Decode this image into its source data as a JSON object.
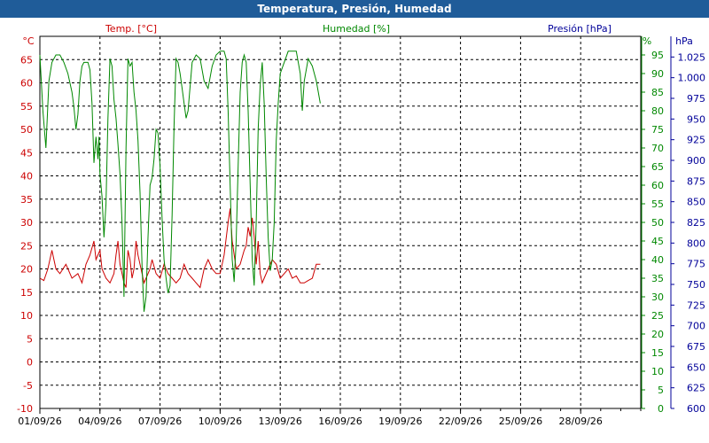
{
  "window": {
    "title": "Temperatura, Presión, Humedad"
  },
  "colors": {
    "temp": "#cc0000",
    "hum": "#008800",
    "pres": "#000099",
    "title_bar": "#1f5c99"
  },
  "chart_data": {
    "type": "line",
    "title": "Temperatura, Presión, Humedad",
    "grid": true,
    "x_ticks": [
      "01/09/26",
      "04/09/26",
      "07/09/26",
      "10/09/26",
      "13/09/26",
      "16/09/26",
      "19/09/26",
      "22/09/26",
      "25/09/26",
      "28/09/26"
    ],
    "x_range": [
      "01/09/26",
      "01/10/26"
    ],
    "axes": {
      "temp": {
        "unit_label": "°C",
        "header": "Temp. [°C]",
        "range": [
          -10,
          70
        ],
        "ticks": [
          -10,
          -5,
          0,
          5,
          10,
          15,
          20,
          25,
          30,
          35,
          40,
          45,
          50,
          55,
          60,
          65
        ]
      },
      "hum": {
        "unit_label": "%",
        "header": "Humedad [%]",
        "range": [
          0,
          100
        ],
        "ticks": [
          0,
          5,
          10,
          15,
          20,
          25,
          30,
          35,
          40,
          45,
          50,
          55,
          60,
          65,
          70,
          75,
          80,
          85,
          90,
          95
        ]
      },
      "pres": {
        "unit_label": "hPa",
        "header": "Presión [hPa]",
        "range": [
          600,
          1050
        ],
        "ticks": [
          "600",
          "625",
          "650",
          "675",
          "700",
          "725",
          "750",
          "775",
          "800",
          "825",
          "850",
          "875",
          "900",
          "925",
          "950",
          "975",
          "1.000",
          "1.025"
        ]
      }
    },
    "series": [
      {
        "name": "Temp. [°C]",
        "axis": "temp",
        "points": [
          [
            0.0,
            18
          ],
          [
            0.2,
            17.5
          ],
          [
            0.4,
            20
          ],
          [
            0.6,
            24
          ],
          [
            0.8,
            20
          ],
          [
            1.0,
            19
          ],
          [
            1.3,
            21
          ],
          [
            1.6,
            18
          ],
          [
            1.9,
            19
          ],
          [
            2.1,
            17
          ],
          [
            2.3,
            21
          ],
          [
            2.5,
            23
          ],
          [
            2.7,
            26
          ],
          [
            2.8,
            22
          ],
          [
            3.0,
            24
          ],
          [
            3.1,
            20
          ],
          [
            3.3,
            18
          ],
          [
            3.5,
            17
          ],
          [
            3.7,
            19
          ],
          [
            3.8,
            23
          ],
          [
            3.9,
            26
          ],
          [
            4.0,
            21
          ],
          [
            4.1,
            19
          ],
          [
            4.2,
            17
          ],
          [
            4.3,
            16
          ],
          [
            4.4,
            24
          ],
          [
            4.5,
            22
          ],
          [
            4.6,
            18
          ],
          [
            4.7,
            20
          ],
          [
            4.8,
            26
          ],
          [
            4.9,
            23
          ],
          [
            5.0,
            21
          ],
          [
            5.1,
            19
          ],
          [
            5.2,
            17
          ],
          [
            5.3,
            18
          ],
          [
            5.5,
            20
          ],
          [
            5.6,
            22
          ],
          [
            5.8,
            19
          ],
          [
            6.0,
            18
          ],
          [
            6.2,
            21
          ],
          [
            6.4,
            19
          ],
          [
            6.6,
            18
          ],
          [
            6.8,
            17
          ],
          [
            7.0,
            18
          ],
          [
            7.2,
            21
          ],
          [
            7.4,
            19
          ],
          [
            7.6,
            18
          ],
          [
            7.8,
            17
          ],
          [
            8.0,
            16
          ],
          [
            8.2,
            20
          ],
          [
            8.4,
            22
          ],
          [
            8.6,
            20
          ],
          [
            8.8,
            19
          ],
          [
            9.0,
            19
          ],
          [
            9.2,
            23
          ],
          [
            9.4,
            30
          ],
          [
            9.5,
            33
          ],
          [
            9.6,
            26
          ],
          [
            9.8,
            20
          ],
          [
            10.0,
            21
          ],
          [
            10.2,
            24
          ],
          [
            10.3,
            25
          ],
          [
            10.4,
            29
          ],
          [
            10.5,
            27
          ],
          [
            10.6,
            31
          ],
          [
            10.7,
            27
          ],
          [
            10.8,
            21
          ],
          [
            10.9,
            26
          ],
          [
            11.0,
            19
          ],
          [
            11.1,
            17
          ],
          [
            11.2,
            18
          ],
          [
            11.4,
            20
          ],
          [
            11.6,
            22
          ],
          [
            11.8,
            21
          ],
          [
            12.0,
            18
          ],
          [
            12.2,
            19
          ],
          [
            12.4,
            20
          ],
          [
            12.6,
            18
          ],
          [
            12.8,
            18.5
          ],
          [
            13.0,
            17
          ],
          [
            13.2,
            17
          ],
          [
            13.4,
            17.5
          ],
          [
            13.6,
            18
          ],
          [
            13.8,
            21
          ],
          [
            14.0,
            21
          ]
        ]
      },
      {
        "name": "Humedad [%]",
        "axis": "hum",
        "points": [
          [
            0.0,
            95
          ],
          [
            0.15,
            80
          ],
          [
            0.3,
            70
          ],
          [
            0.45,
            88
          ],
          [
            0.6,
            93
          ],
          [
            0.8,
            95
          ],
          [
            1.0,
            95
          ],
          [
            1.2,
            93
          ],
          [
            1.4,
            90
          ],
          [
            1.6,
            85
          ],
          [
            1.7,
            81
          ],
          [
            1.8,
            75
          ],
          [
            1.9,
            79
          ],
          [
            2.0,
            88
          ],
          [
            2.1,
            92
          ],
          [
            2.2,
            93
          ],
          [
            2.4,
            93
          ],
          [
            2.5,
            91
          ],
          [
            2.6,
            82
          ],
          [
            2.7,
            66
          ],
          [
            2.8,
            73
          ],
          [
            2.9,
            67
          ],
          [
            2.95,
            73
          ],
          [
            3.0,
            63
          ],
          [
            3.1,
            57
          ],
          [
            3.2,
            46
          ],
          [
            3.3,
            55
          ],
          [
            3.4,
            78
          ],
          [
            3.5,
            94
          ],
          [
            3.6,
            92
          ],
          [
            3.7,
            83
          ],
          [
            3.8,
            78
          ],
          [
            3.9,
            71
          ],
          [
            4.0,
            63
          ],
          [
            4.1,
            50
          ],
          [
            4.2,
            30
          ],
          [
            4.3,
            70
          ],
          [
            4.4,
            94
          ],
          [
            4.5,
            92
          ],
          [
            4.6,
            93
          ],
          [
            4.7,
            85
          ],
          [
            4.8,
            80
          ],
          [
            4.9,
            72
          ],
          [
            5.0,
            58
          ],
          [
            5.1,
            38
          ],
          [
            5.2,
            26
          ],
          [
            5.3,
            30
          ],
          [
            5.4,
            46
          ],
          [
            5.5,
            60
          ],
          [
            5.6,
            62
          ],
          [
            5.7,
            67
          ],
          [
            5.8,
            75
          ],
          [
            5.9,
            74
          ],
          [
            6.0,
            65
          ],
          [
            6.1,
            51
          ],
          [
            6.2,
            40
          ],
          [
            6.3,
            35
          ],
          [
            6.4,
            31
          ],
          [
            6.5,
            33
          ],
          [
            6.6,
            52
          ],
          [
            6.7,
            76
          ],
          [
            6.8,
            94
          ],
          [
            6.9,
            93
          ],
          [
            7.0,
            90
          ],
          [
            7.1,
            86
          ],
          [
            7.2,
            82
          ],
          [
            7.3,
            78
          ],
          [
            7.4,
            80
          ],
          [
            7.6,
            93
          ],
          [
            7.8,
            95
          ],
          [
            8.0,
            94
          ],
          [
            8.2,
            88
          ],
          [
            8.4,
            86
          ],
          [
            8.6,
            92
          ],
          [
            8.8,
            95
          ],
          [
            9.0,
            96
          ],
          [
            9.2,
            96
          ],
          [
            9.3,
            94
          ],
          [
            9.4,
            80
          ],
          [
            9.5,
            60
          ],
          [
            9.6,
            40
          ],
          [
            9.7,
            34
          ],
          [
            9.8,
            45
          ],
          [
            9.9,
            65
          ],
          [
            10.0,
            85
          ],
          [
            10.1,
            93
          ],
          [
            10.2,
            95
          ],
          [
            10.3,
            93
          ],
          [
            10.4,
            80
          ],
          [
            10.5,
            60
          ],
          [
            10.6,
            40
          ],
          [
            10.7,
            33
          ],
          [
            10.8,
            50
          ],
          [
            10.9,
            75
          ],
          [
            11.0,
            87
          ],
          [
            11.1,
            93
          ],
          [
            11.2,
            82
          ],
          [
            11.3,
            62
          ],
          [
            11.4,
            46
          ],
          [
            11.5,
            37
          ],
          [
            11.6,
            40
          ],
          [
            11.7,
            50
          ],
          [
            11.8,
            72
          ],
          [
            11.9,
            82
          ],
          [
            12.0,
            90
          ],
          [
            12.2,
            93
          ],
          [
            12.4,
            96
          ],
          [
            12.6,
            96
          ],
          [
            12.8,
            96
          ],
          [
            13.0,
            90
          ],
          [
            13.1,
            80
          ],
          [
            13.2,
            88
          ],
          [
            13.4,
            94
          ],
          [
            13.6,
            92
          ],
          [
            13.8,
            88
          ],
          [
            14.0,
            82
          ]
        ]
      }
    ]
  }
}
